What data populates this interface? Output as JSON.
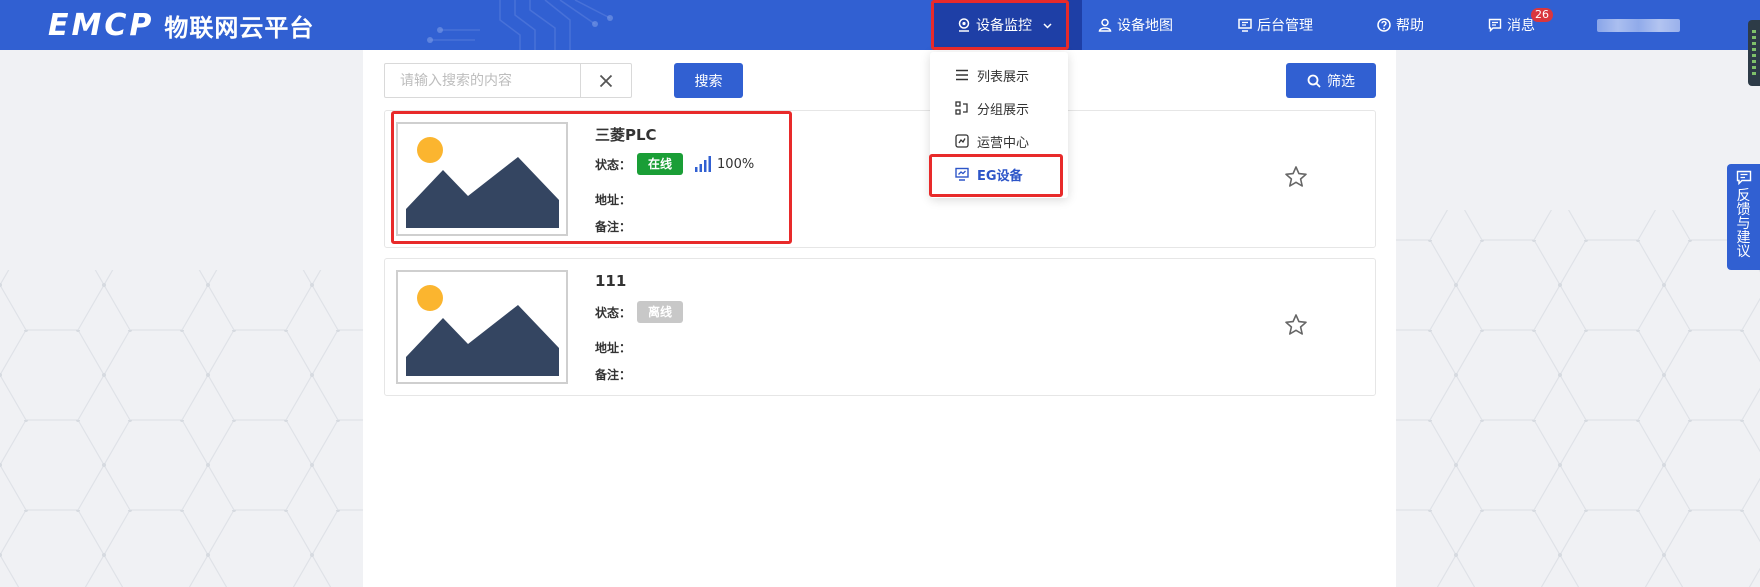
{
  "brand": {
    "logo_text": "EMCP",
    "platform_name": "物联网云平台"
  },
  "nav": {
    "monitor": "设备监控",
    "map": "设备地图",
    "admin": "后台管理",
    "help": "帮助",
    "messages": "消息",
    "message_count": "26"
  },
  "dropdown": {
    "items": [
      {
        "label": "列表展示",
        "icon": "list-icon"
      },
      {
        "label": "分组展示",
        "icon": "group-icon"
      },
      {
        "label": "运营中心",
        "icon": "dashboard-icon"
      },
      {
        "label": "EG设备",
        "icon": "eg-device-icon"
      }
    ],
    "selected": "EG设备"
  },
  "search": {
    "placeholder": "请输入搜索的内容",
    "value": "",
    "button": "搜索"
  },
  "filter_button": "筛选",
  "devices": [
    {
      "name": "三菱PLC",
      "status_label": "状态：",
      "status": "在线",
      "signal": "100%",
      "address_label": "地址：",
      "note_label": "备注：",
      "favorite": false
    },
    {
      "name": "111",
      "status_label": "状态：",
      "status": "离线",
      "address_label": "地址：",
      "note_label": "备注：",
      "favorite": false
    }
  ],
  "feedback": "反馈与建议",
  "colors": {
    "header": "#3160d2",
    "active_nav": "#1e3fa6",
    "online": "#1a9e36",
    "offline": "#c8c8c8",
    "highlight": "#e82a2a",
    "badge": "#d9363e"
  }
}
